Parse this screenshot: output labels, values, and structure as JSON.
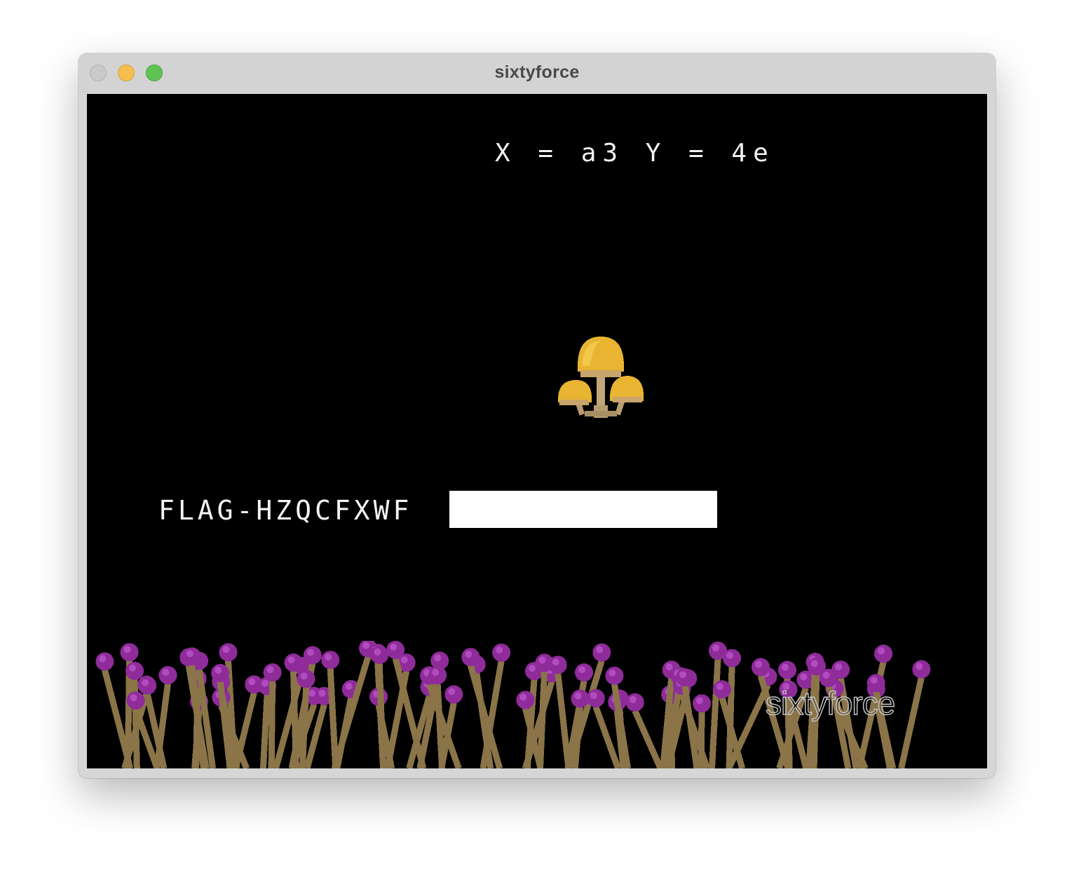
{
  "window": {
    "title": "sixtyforce"
  },
  "game": {
    "hud_text": "X = a3 Y = 4e",
    "flag_text": "FLAG-HZQCFXWF",
    "watermark": "sixtyforce",
    "sprites": [
      "mushroom-cluster-icon",
      "purple-flower-plants"
    ]
  },
  "colors": {
    "screen_bg": "#000000",
    "mushroom_cap": "#e8b431",
    "mushroom_stem": "#c2a77a",
    "plant_stem": "#8a7448",
    "plant_bud": "#8f2c9a"
  }
}
